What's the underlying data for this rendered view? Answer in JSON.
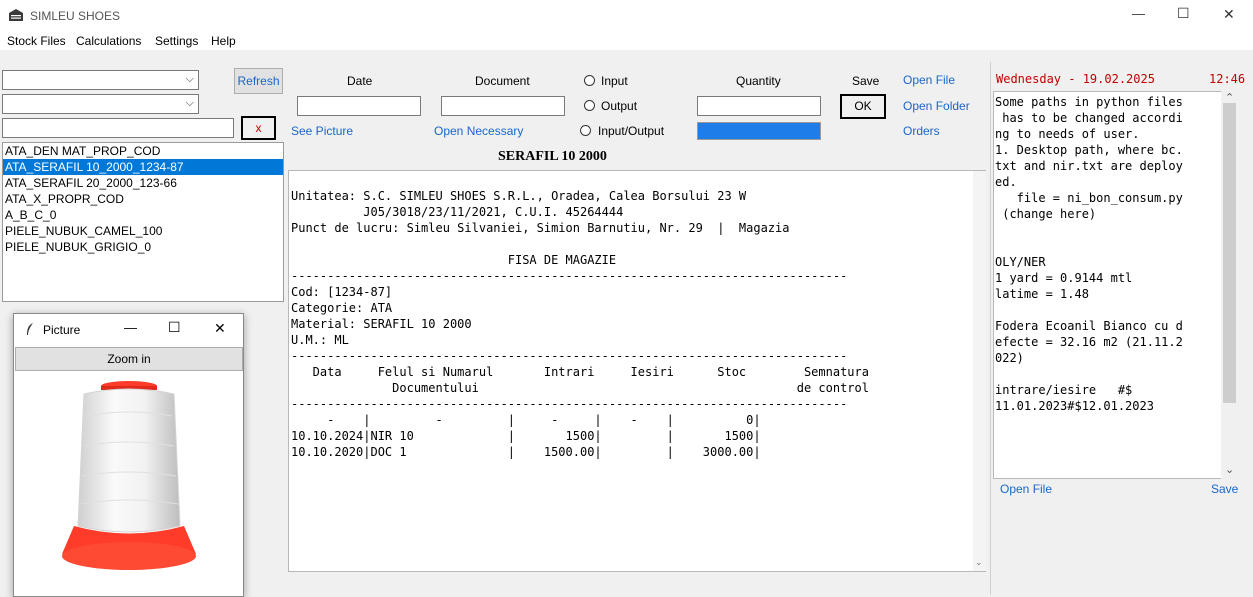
{
  "window": {
    "title": "SIMLEU SHOES",
    "minimize": "—",
    "maximize": "☐",
    "close": "✕"
  },
  "menu": [
    "Stock Files",
    "Calculations",
    "Settings",
    "Help"
  ],
  "left": {
    "combo1_value": "",
    "combo2_value": "",
    "refresh_label": "Refresh",
    "search_value": "",
    "clear_label": "x",
    "items": [
      "ATA_DEN MAT_PROP_COD",
      "ATA_SERAFIL 10_2000_1234-87",
      "ATA_SERAFIL 20_2000_123-66",
      "ATA_X_PROPR_COD",
      "A_B_C_0",
      "PIELE_NUBUK_CAMEL_100",
      "PIELE_NUBUK_GRIGIO_0"
    ],
    "selected_index": 1
  },
  "picture_window": {
    "title": "Picture",
    "zoom_label": "Zoom in",
    "minimize": "—",
    "maximize": "☐",
    "close": "✕"
  },
  "form": {
    "date_label": "Date",
    "document_label": "Document",
    "quantity_label": "Quantity",
    "save_label": "Save",
    "ok_label": "OK",
    "open_file": "Open File",
    "open_folder": "Open Folder",
    "orders": "Orders",
    "see_picture": "See Picture",
    "open_necessary": "Open Necessary",
    "radio_input": "Input",
    "radio_output": "Output",
    "radio_inout": "Input/Output",
    "date_value": "",
    "document_value": "",
    "quantity_value": ""
  },
  "doc": {
    "title": "SERAFIL 10 2000",
    "lines": [
      "Unitatea: S.C. SIMLEU SHOES S.R.L., Oradea, Calea Borsului 23 W",
      "          J05/3018/23/11/2021, C.U.I. 45264444",
      "Punct de lucru: Simleu Silvaniei, Simion Barnutiu, Nr. 29  |  Magazia",
      "",
      "                              FISA DE MAGAZIE",
      "-----------------------------------------------------------------------------",
      "Cod: [1234-87]",
      "Categorie: ATA",
      "Material: SERAFIL 10 2000",
      "U.M.: ML",
      "-----------------------------------------------------------------------------",
      "   Data     Felul si Numarul       Intrari     Iesiri      Stoc        Semnatura",
      "              Documentului                                            de control",
      "-----------------------------------------------------------------------------",
      "     -    |         -         |     -     |    -    |          0|",
      "10.10.2024|NIR 10             |       1500|         |       1500|",
      "10.10.2020|DOC 1              |    1500.00|         |    3000.00|"
    ]
  },
  "notes": {
    "day_date": "Wednesday - 19.02.2025",
    "time": "12:46",
    "lines": [
      "Some paths in python files",
      " has to be changed accordi",
      "ng to needs of user.",
      "1. Desktop path, where bc.",
      "txt and nir.txt are deploy",
      "ed.",
      "   file = ni_bon_consum.py",
      " (change here)",
      "",
      "",
      "OLY/NER",
      "1 yard = 0.9144 mtl",
      "latime = 1.48",
      "",
      "Fodera Ecoanil Bianco cu d",
      "efecte = 32.16 m2 (21.11.2",
      "022)",
      "",
      "intrare/iesire   #$",
      "11.01.2023#$12.01.2023"
    ],
    "open_file": "Open File",
    "save": "Save"
  },
  "colors": {
    "selection": "#0078d7",
    "link": "#1a66c9",
    "date_red": "#c00000",
    "spool_red": "#ff3b2a"
  }
}
